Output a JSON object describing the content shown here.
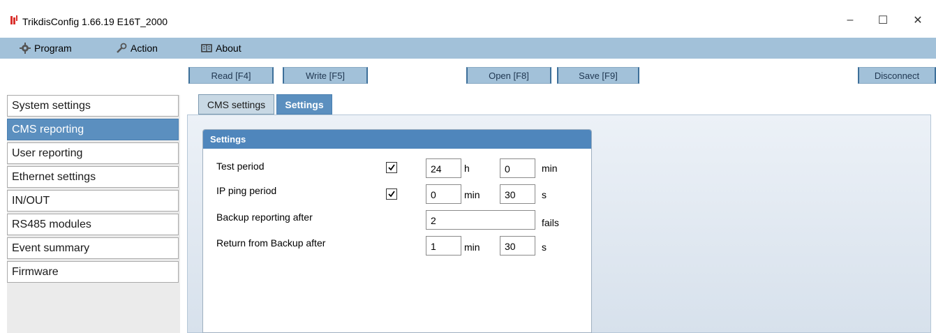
{
  "window": {
    "title": "TrikdisConfig 1.66.19   E16T_2000",
    "minimize": "–",
    "maximize": "☐",
    "close": "✕"
  },
  "menu": {
    "program": "Program",
    "action": "Action",
    "about": "About"
  },
  "toolbar": {
    "read": "Read [F4]",
    "write": "Write [F5]",
    "open": "Open [F8]",
    "save": "Save [F9]",
    "disconnect": "Disconnect"
  },
  "sidebar": {
    "items": [
      {
        "label": "System settings"
      },
      {
        "label": "CMS reporting"
      },
      {
        "label": "User reporting"
      },
      {
        "label": "Ethernet settings"
      },
      {
        "label": "IN/OUT"
      },
      {
        "label": "RS485 modules"
      },
      {
        "label": "Event summary"
      },
      {
        "label": "Firmware"
      }
    ],
    "active": "CMS reporting"
  },
  "tabs": {
    "cms_settings": "CMS settings",
    "settings": "Settings"
  },
  "settings": {
    "header": "Settings",
    "test_period": {
      "label": "Test period",
      "checked": true,
      "value1": "24",
      "unit1": "h",
      "value2": "0",
      "unit2": "min"
    },
    "ip_ping_period": {
      "label": "IP ping period",
      "checked": true,
      "value1": "0",
      "unit1": "min",
      "value2": "30",
      "unit2": "s"
    },
    "backup_reporting": {
      "label": "Backup reporting after",
      "value": "2",
      "unit": "fails"
    },
    "return_from_backup": {
      "label": "Return from Backup after",
      "value1": "1",
      "unit1": "min",
      "value2": "30",
      "unit2": "s"
    }
  }
}
